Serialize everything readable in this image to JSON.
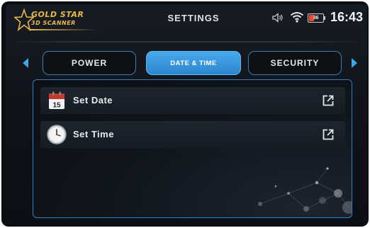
{
  "logo": {
    "line1": "GOLD STAR",
    "line2": "3D SCANNER"
  },
  "header": {
    "title": "SETTINGS",
    "clock": "16:43"
  },
  "status": {
    "battery_percent": 36,
    "battery_label": "36"
  },
  "tabs": [
    {
      "label": "POWER"
    },
    {
      "label": "DATE & TIME",
      "selected": true
    },
    {
      "label": "SECURITY"
    }
  ],
  "list": [
    {
      "label": "Set Date",
      "icon": "calendar-icon",
      "calendar_day": "15"
    },
    {
      "label": "Set Time",
      "icon": "clock-icon"
    }
  ],
  "colors": {
    "accent": "#3fa6e8",
    "selected_tab": "#3a96dc",
    "logo_gold": "#e8b84a",
    "battery_low": "#e24b2c"
  }
}
